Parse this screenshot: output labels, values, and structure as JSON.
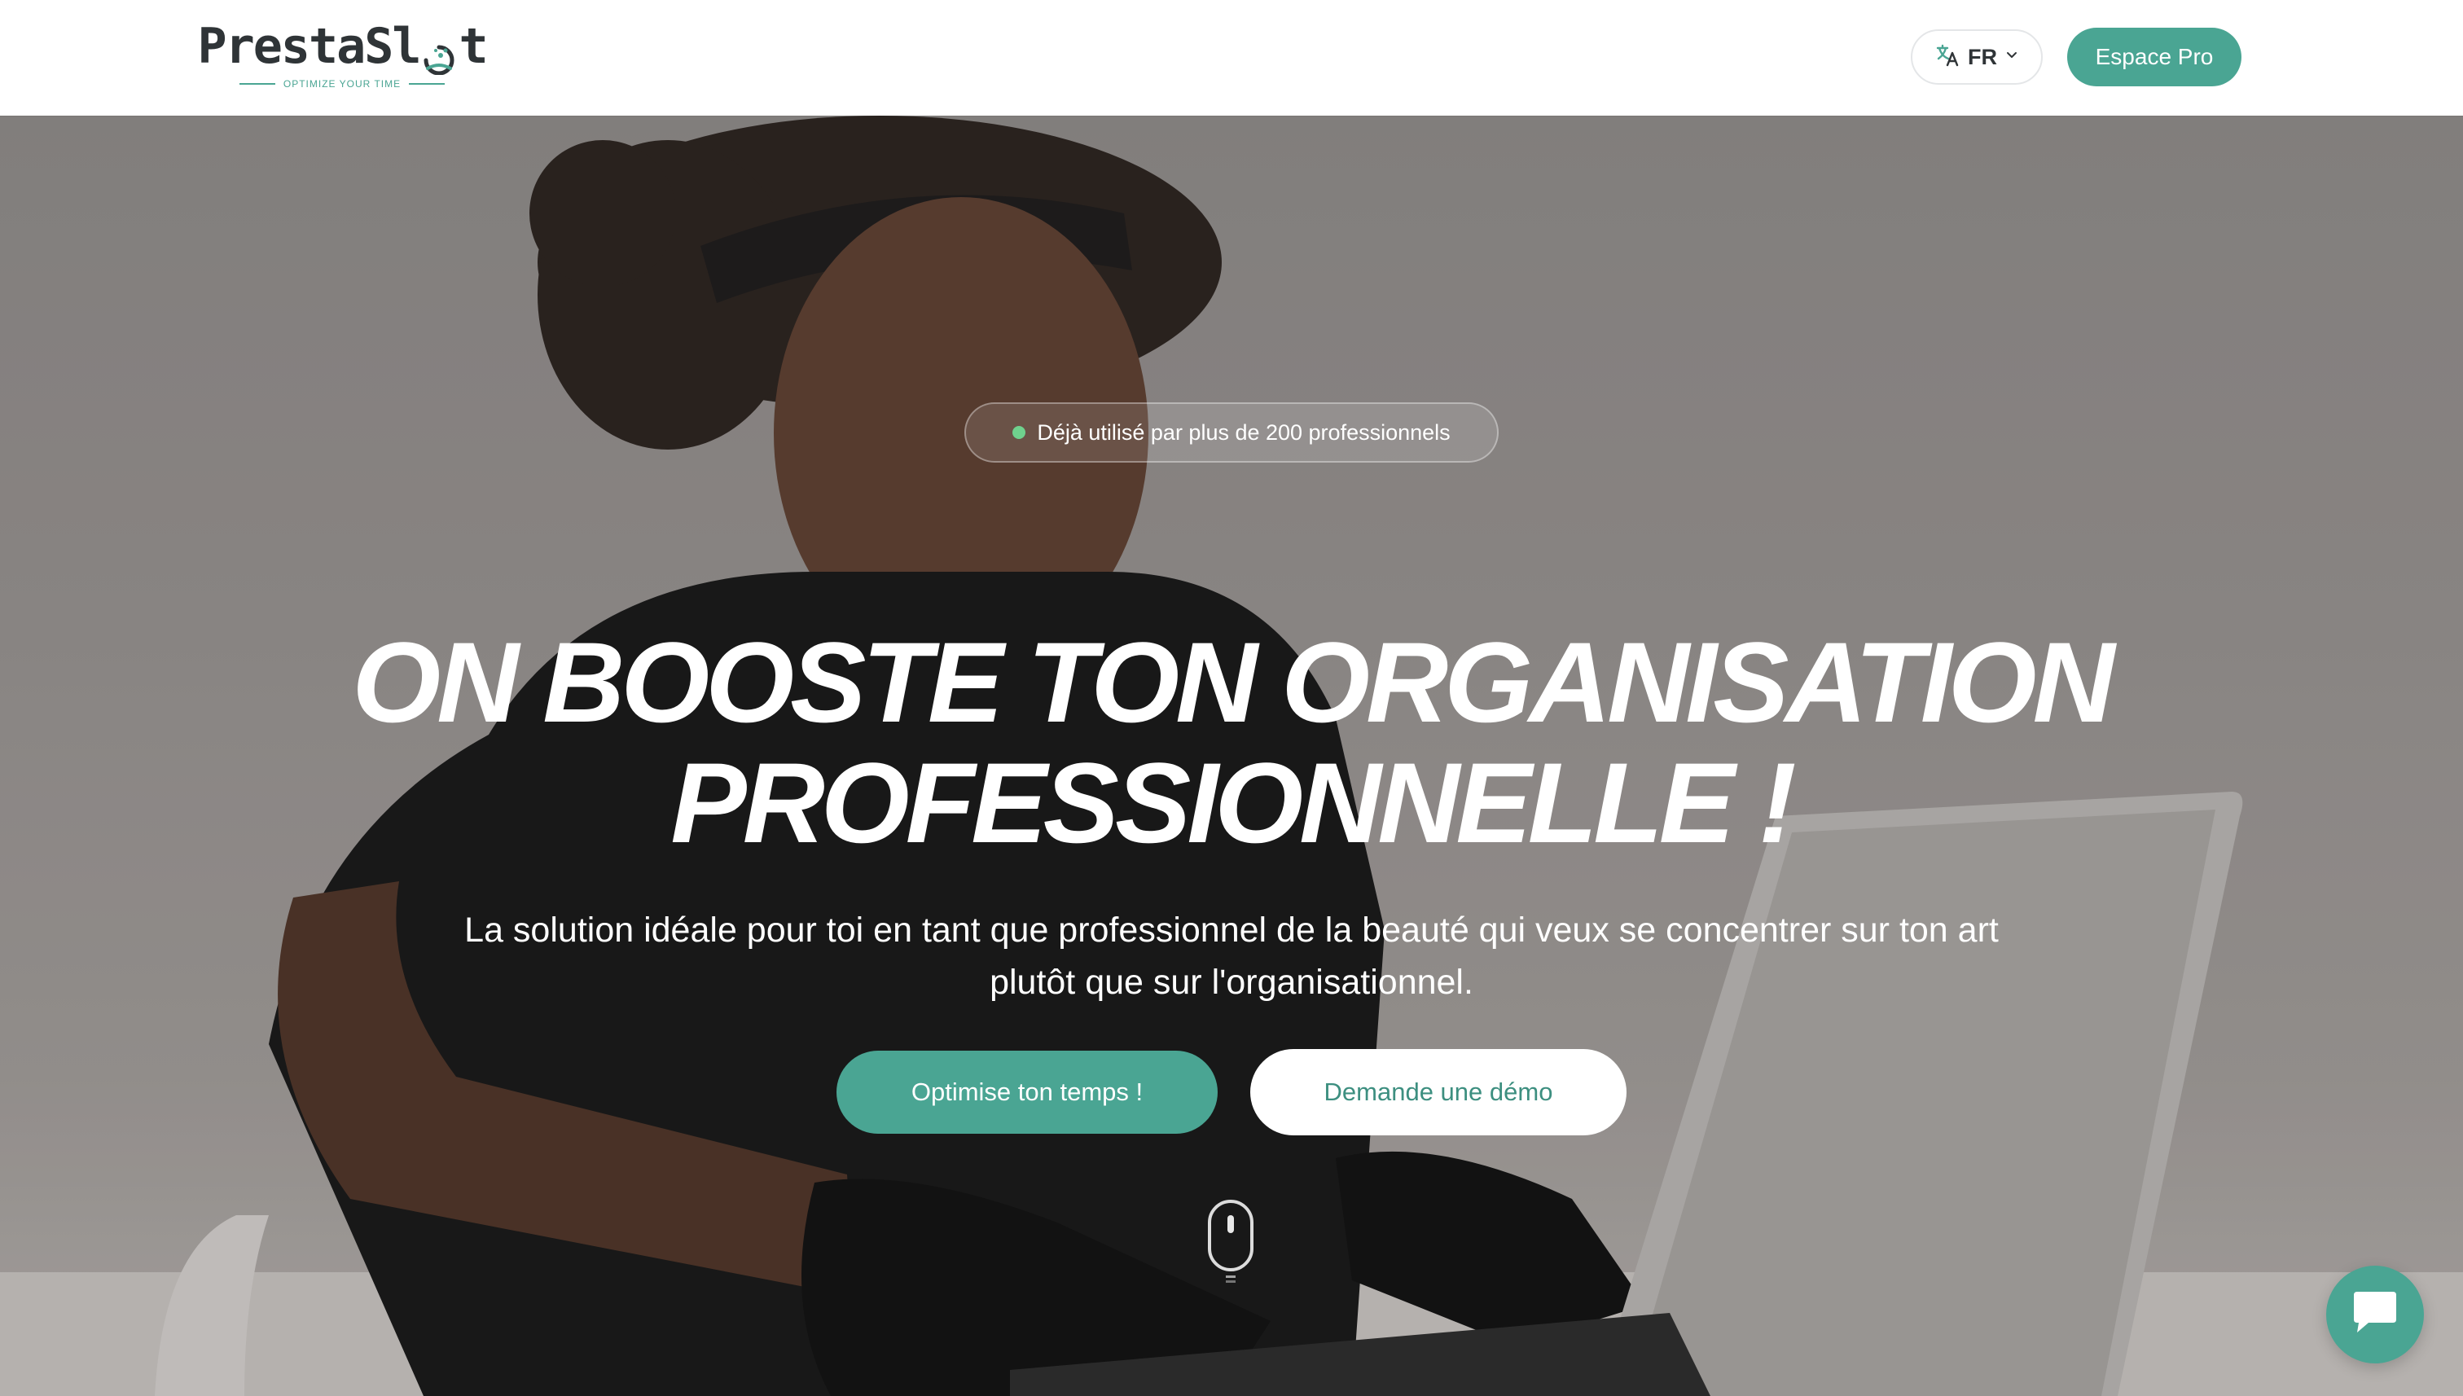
{
  "header": {
    "logo": {
      "wordmark_before": "PrestaSl",
      "wordmark_after": "t",
      "tagline": "OPTIMIZE YOUR TIME"
    },
    "language": {
      "code": "FR",
      "icon": "translate-icon"
    },
    "espace_pro_label": "Espace Pro"
  },
  "hero": {
    "badge_text": "Déjà utilisé par plus de 200 professionnels",
    "headline_line1": "ON BOOSTE TON ORGANISATION",
    "headline_line2": "PROFESSIONNELLE !",
    "subtitle_line1": "La solution idéale pour toi en tant que professionnel de la beauté qui veux se concentrer sur ton art",
    "subtitle_line2": "plutôt que sur l'organisationnel.",
    "cta_primary": "Optimise ton temps !",
    "cta_secondary": "Demande une démo",
    "scroll_icon": "mouse-scroll-icon"
  },
  "chat": {
    "icon": "chat-bubble-icon"
  },
  "colors": {
    "accent": "#4aa593",
    "badge_dot": "#6fd18d",
    "text_dark": "#2f3437"
  }
}
